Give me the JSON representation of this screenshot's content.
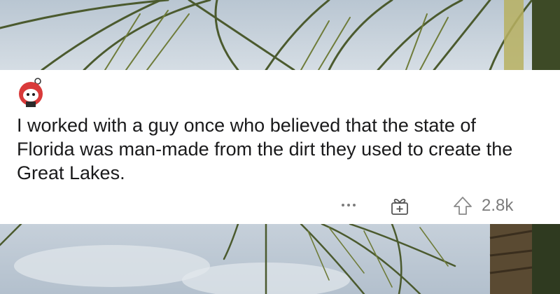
{
  "comment": {
    "text": "I worked with a guy once who believed that the state of Florida was man-made from the dirt they used to create the Great Lakes."
  },
  "actions": {
    "more_icon": "ellipsis-icon",
    "award_icon": "gift-icon",
    "upvote_icon": "upvote-arrow-icon",
    "score": "2.8k"
  },
  "colors": {
    "text": "#1a1a1b",
    "muted": "#7c7c7c",
    "card": "#ffffff",
    "avatar_red": "#d93a3a"
  }
}
